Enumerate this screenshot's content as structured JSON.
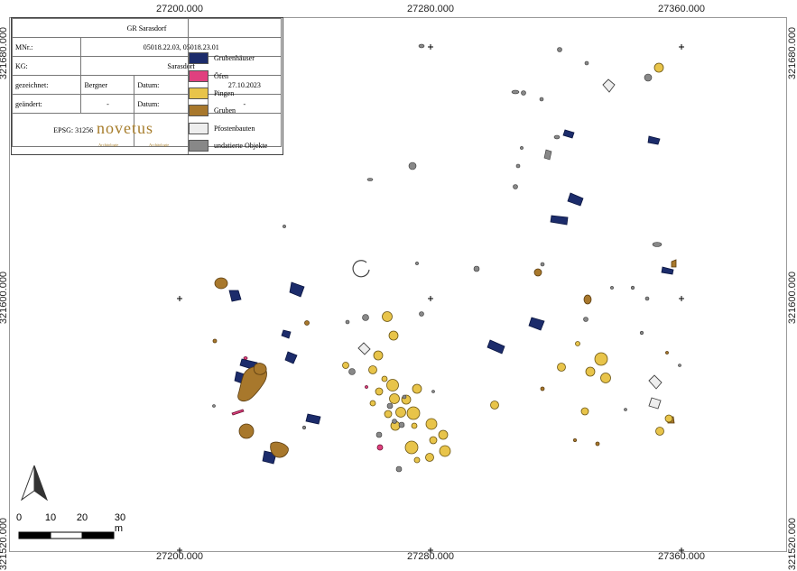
{
  "map": {
    "coords_top": [
      "27200.000",
      "27280.000",
      "27360.000"
    ],
    "coords_bottom": [
      "27200.000",
      "27280.000",
      "27360.000"
    ],
    "coords_left": [
      "321680.000",
      "321600.000",
      "321520.000"
    ],
    "coords_right": [
      "321680.000",
      "321600.000",
      "321520.000"
    ]
  },
  "infobox": {
    "title": "GR Sarasdorf",
    "mnr_label": "MNr.:",
    "mnr_value": "05018.22.03, 05018.23.01",
    "kg_label": "KG:",
    "kg_value": "Sarasdorf",
    "drawn_label": "gezeichnet:",
    "drawn_by": "Bergner",
    "date_label": "Datum:",
    "drawn_date": "27.10.2023",
    "changed_label": "geändert:",
    "changed_by": "-",
    "changed_date": "-",
    "epsg": "EPSG: 31256",
    "logo_text": "novetus",
    "logo_sub_left": "Archäologie",
    "logo_sub_right": "Archäologie"
  },
  "legend": [
    {
      "label": "Grubenhäuser",
      "color": "#1c2c6b"
    },
    {
      "label": "Öfen",
      "color": "#e0407f"
    },
    {
      "label": "Pingen",
      "color": "#e8c44a"
    },
    {
      "label": "Gruben",
      "color": "#a8782c"
    },
    {
      "label": "Pfostenbauten",
      "color": "#eeeeee"
    },
    {
      "label": "undatierte Objekte",
      "color": "#888888"
    }
  ],
  "scalebar": {
    "labels": [
      "0",
      "10",
      "20",
      "30 m"
    ]
  },
  "colors": {
    "grubenhaus": "#1c2c6b",
    "ofen": "#e0407f",
    "pinge": "#e8c44a",
    "grube": "#a8782c",
    "pfosten": "#eeeeee",
    "undatiert": "#888888"
  }
}
